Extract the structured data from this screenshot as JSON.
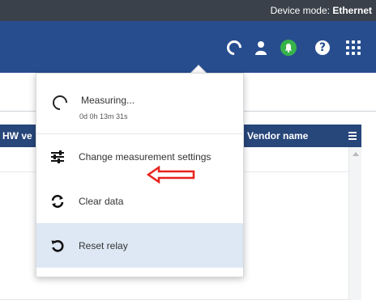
{
  "statusbar": {
    "device_mode_label": "Device mode:",
    "device_mode_value": "Ethernet"
  },
  "header": {
    "icons": [
      "loading-spinner-icon",
      "user-icon",
      "bell-icon",
      "help-icon",
      "apps-grid-icon"
    ],
    "colors": {
      "header_bg": "#274d8f",
      "statusbar_bg": "#3a414a",
      "bell_bg": "#37b34a"
    }
  },
  "table": {
    "columns": [
      "HW ve",
      "Vendor name"
    ],
    "header_bg": "#27467a"
  },
  "dropdown": {
    "status": {
      "title": "Measuring...",
      "elapsed": "0d 0h 13m 31s"
    },
    "items": [
      {
        "label": "Change measurement settings",
        "icon": "sliders-icon"
      },
      {
        "label": "Clear data",
        "icon": "refresh-icon"
      },
      {
        "label": "Reset relay",
        "icon": "reset-icon",
        "highlighted": true
      }
    ],
    "highlight_color": "#dde8f4"
  },
  "annotation": {
    "arrow_color": "#e8221c"
  }
}
